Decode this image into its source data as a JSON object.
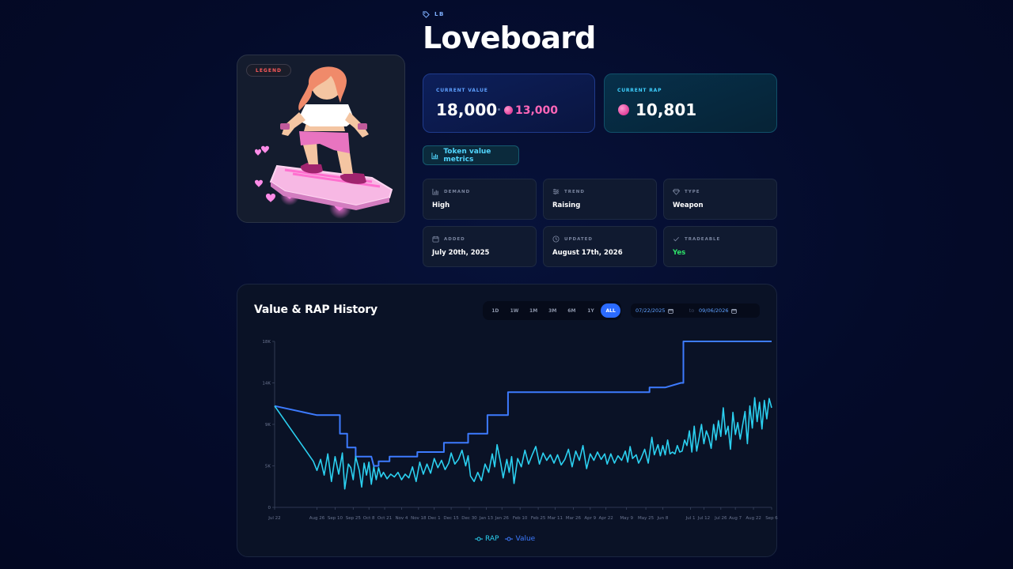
{
  "header": {
    "tag": "LB",
    "title": "Loveboard"
  },
  "item": {
    "rarity": "LEGEND"
  },
  "value_card": {
    "label": "CURRENT VALUE",
    "value": "18,000",
    "token_value": "13,000"
  },
  "rap_card": {
    "label": "CURRENT RAP",
    "value": "10,801"
  },
  "metrics_button": {
    "label": "Token value metrics"
  },
  "tiles": [
    {
      "label": "DEMAND",
      "value": "High",
      "icon": "bar-chart-icon"
    },
    {
      "label": "TREND",
      "value": "Raising",
      "icon": "sliders-icon"
    },
    {
      "label": "TYPE",
      "value": "Weapon",
      "icon": "diamond-icon"
    },
    {
      "label": "ADDED",
      "value": "July 20th, 2025",
      "icon": "calendar-icon"
    },
    {
      "label": "UPDATED",
      "value": "August 17th, 2026",
      "icon": "clock-icon"
    },
    {
      "label": "TRADEABLE",
      "value": "Yes",
      "icon": "check-icon"
    }
  ],
  "chart_panel": {
    "title": "Value & RAP History",
    "ranges": [
      "1D",
      "1W",
      "1M",
      "3M",
      "6M",
      "1Y",
      "ALL"
    ],
    "active_range": "ALL",
    "date_from": "07/22/2025",
    "date_to_sep": "to",
    "date_to": "09/06/2026",
    "legend": [
      "RAP",
      "Value"
    ]
  },
  "colors": {
    "accent": "#2b6bff",
    "value_line": "#3d7bff",
    "rap_line": "#2bd0f0",
    "token": "#ff66b8",
    "tradeable_yes": "#2ee36a"
  },
  "chart_data": {
    "type": "line",
    "xlabel": "",
    "ylabel": "",
    "ylim": [
      0,
      18000
    ],
    "y_ticks": [
      "0",
      "5K",
      "9K",
      "14K",
      "18K"
    ],
    "y_tick_values": [
      0,
      4500,
      9000,
      13500,
      18000
    ],
    "x_ticks": [
      "Jul 22",
      "Aug 26",
      "Sep 10",
      "Sep 25",
      "Oct 8",
      "Oct 21",
      "Nov 4",
      "Nov 18",
      "Dec 1",
      "Dec 15",
      "Dec 30",
      "Jan 13",
      "Jan 26",
      "Feb 10",
      "Feb 25",
      "Mar 11",
      "Mar 26",
      "Apr 9",
      "Apr 22",
      "May 9",
      "May 25",
      "Jun 8",
      "Jul 1",
      "Jul 12",
      "Jul 26",
      "Aug 7",
      "Aug 22",
      "Sep 6"
    ],
    "x_tick_days": [
      0,
      35,
      50,
      65,
      78,
      91,
      105,
      119,
      132,
      146,
      161,
      175,
      188,
      203,
      218,
      232,
      247,
      261,
      274,
      291,
      307,
      321,
      344,
      355,
      369,
      381,
      396,
      411
    ],
    "x_range": [
      0,
      411
    ],
    "grid": false,
    "legend_position": "bottom",
    "series": [
      {
        "name": "Value",
        "points": [
          [
            0,
            11000
          ],
          [
            35,
            10000
          ],
          [
            54,
            10000
          ],
          [
            54,
            8000
          ],
          [
            60,
            8000
          ],
          [
            60,
            6500
          ],
          [
            67,
            6500
          ],
          [
            67,
            5500
          ],
          [
            80,
            5500
          ],
          [
            82,
            4500
          ],
          [
            86,
            4500
          ],
          [
            86,
            5000
          ],
          [
            95,
            5000
          ],
          [
            95,
            5500
          ],
          [
            118,
            5500
          ],
          [
            118,
            6000
          ],
          [
            140,
            6000
          ],
          [
            140,
            7000
          ],
          [
            160,
            7000
          ],
          [
            160,
            8000
          ],
          [
            176,
            8000
          ],
          [
            176,
            10000
          ],
          [
            193,
            10000
          ],
          [
            193,
            12500
          ],
          [
            310,
            12500
          ],
          [
            310,
            13000
          ],
          [
            323,
            13000
          ],
          [
            336,
            13500
          ],
          [
            338,
            13500
          ],
          [
            338,
            18000
          ],
          [
            411,
            18000
          ]
        ]
      },
      {
        "name": "RAP",
        "points": [
          [
            0,
            11000
          ],
          [
            8,
            9500
          ],
          [
            16,
            8000
          ],
          [
            24,
            6500
          ],
          [
            32,
            5000
          ],
          [
            35,
            4000
          ],
          [
            38,
            5200
          ],
          [
            41,
            3500
          ],
          [
            44,
            5800
          ],
          [
            47,
            2800
          ],
          [
            50,
            5500
          ],
          [
            53,
            3600
          ],
          [
            56,
            5900
          ],
          [
            58,
            2000
          ],
          [
            61,
            4700
          ],
          [
            63,
            4300
          ],
          [
            65,
            3000
          ],
          [
            67,
            5500
          ],
          [
            70,
            4000
          ],
          [
            72,
            2200
          ],
          [
            74,
            4800
          ],
          [
            76,
            3500
          ],
          [
            78,
            4900
          ],
          [
            80,
            2500
          ],
          [
            82,
            4400
          ],
          [
            84,
            3000
          ],
          [
            86,
            4300
          ],
          [
            88,
            3300
          ],
          [
            90,
            3800
          ],
          [
            93,
            3100
          ],
          [
            96,
            3600
          ],
          [
            99,
            3300
          ],
          [
            102,
            3800
          ],
          [
            105,
            3000
          ],
          [
            108,
            3600
          ],
          [
            111,
            3200
          ],
          [
            114,
            4400
          ],
          [
            117,
            2800
          ],
          [
            120,
            4900
          ],
          [
            123,
            3600
          ],
          [
            126,
            4700
          ],
          [
            129,
            3700
          ],
          [
            132,
            5300
          ],
          [
            135,
            4300
          ],
          [
            138,
            5100
          ],
          [
            141,
            4100
          ],
          [
            144,
            4800
          ],
          [
            146,
            5900
          ],
          [
            149,
            4700
          ],
          [
            152,
            5200
          ],
          [
            155,
            6200
          ],
          [
            158,
            4500
          ],
          [
            160,
            5600
          ],
          [
            162,
            3400
          ],
          [
            165,
            2800
          ],
          [
            168,
            3800
          ],
          [
            171,
            2900
          ],
          [
            174,
            4700
          ],
          [
            177,
            3800
          ],
          [
            180,
            5800
          ],
          [
            182,
            4400
          ],
          [
            184,
            6800
          ],
          [
            187,
            4800
          ],
          [
            189,
            3200
          ],
          [
            192,
            5200
          ],
          [
            194,
            3800
          ],
          [
            196,
            5500
          ],
          [
            198,
            2600
          ],
          [
            201,
            5300
          ],
          [
            204,
            4400
          ],
          [
            207,
            6200
          ],
          [
            210,
            4700
          ],
          [
            213,
            5700
          ],
          [
            216,
            6600
          ],
          [
            219,
            4700
          ],
          [
            222,
            5900
          ],
          [
            225,
            5100
          ],
          [
            228,
            5700
          ],
          [
            231,
            4800
          ],
          [
            234,
            5700
          ],
          [
            237,
            4600
          ],
          [
            240,
            5200
          ],
          [
            243,
            6300
          ],
          [
            246,
            4400
          ],
          [
            249,
            6100
          ],
          [
            252,
            5100
          ],
          [
            255,
            6700
          ],
          [
            258,
            4200
          ],
          [
            261,
            5800
          ],
          [
            264,
            5100
          ],
          [
            267,
            6000
          ],
          [
            270,
            5200
          ],
          [
            273,
            5800
          ],
          [
            275,
            4700
          ],
          [
            278,
            5800
          ],
          [
            281,
            4800
          ],
          [
            284,
            5600
          ],
          [
            287,
            5100
          ],
          [
            290,
            6100
          ],
          [
            292,
            4900
          ],
          [
            294,
            6600
          ],
          [
            296,
            5300
          ],
          [
            299,
            5700
          ],
          [
            301,
            4800
          ],
          [
            303,
            5300
          ],
          [
            306,
            6300
          ],
          [
            309,
            4800
          ],
          [
            312,
            7600
          ],
          [
            314,
            5700
          ],
          [
            317,
            6800
          ],
          [
            319,
            5600
          ],
          [
            321,
            6700
          ],
          [
            323,
            5700
          ],
          [
            325,
            7300
          ],
          [
            327,
            5800
          ],
          [
            329,
            6000
          ],
          [
            331,
            5800
          ],
          [
            333,
            6700
          ],
          [
            335,
            6000
          ],
          [
            337,
            6100
          ],
          [
            339,
            7300
          ],
          [
            341,
            6700
          ],
          [
            343,
            8300
          ],
          [
            345,
            6000
          ],
          [
            347,
            8800
          ],
          [
            349,
            6100
          ],
          [
            351,
            7500
          ],
          [
            353,
            9000
          ],
          [
            355,
            6900
          ],
          [
            357,
            8300
          ],
          [
            359,
            7600
          ],
          [
            361,
            6400
          ],
          [
            363,
            9000
          ],
          [
            365,
            7300
          ],
          [
            367,
            9400
          ],
          [
            369,
            7700
          ],
          [
            371,
            10800
          ],
          [
            373,
            7900
          ],
          [
            375,
            8800
          ],
          [
            377,
            6300
          ],
          [
            379,
            10300
          ],
          [
            381,
            7900
          ],
          [
            383,
            9200
          ],
          [
            385,
            7400
          ],
          [
            387,
            8900
          ],
          [
            389,
            10400
          ],
          [
            391,
            6900
          ],
          [
            393,
            11000
          ],
          [
            395,
            8600
          ],
          [
            397,
            11900
          ],
          [
            399,
            9300
          ],
          [
            401,
            11400
          ],
          [
            403,
            8500
          ],
          [
            405,
            11600
          ],
          [
            407,
            9600
          ],
          [
            409,
            11800
          ],
          [
            411,
            10801
          ]
        ]
      }
    ]
  }
}
